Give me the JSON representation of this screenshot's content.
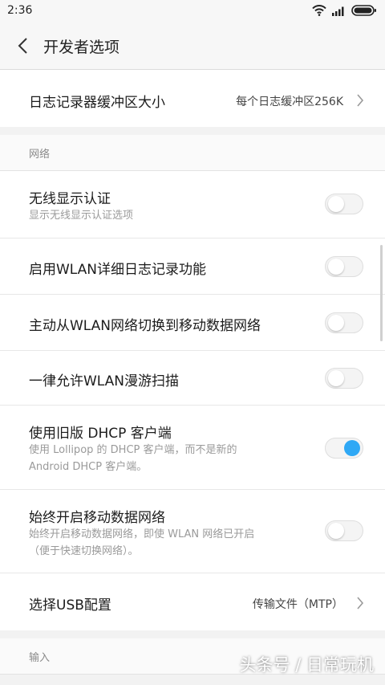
{
  "status_bar": {
    "time": "2:36"
  },
  "header": {
    "title": "开发者选项"
  },
  "log_buffer": {
    "label": "日志记录器缓冲区大小",
    "value": "每个日志缓冲区256K"
  },
  "network_section": {
    "title": "网络"
  },
  "items": [
    {
      "label": "无线显示认证",
      "sub": "显示无线显示认证选项",
      "toggle_on": false
    },
    {
      "label": "启用WLAN详细日志记录功能",
      "toggle_on": false
    },
    {
      "label": "主动从WLAN网络切换到移动数据网络",
      "toggle_on": false
    },
    {
      "label": "一律允许WLAN漫游扫描",
      "toggle_on": false
    },
    {
      "label": "使用旧版 DHCP 客户端",
      "sub1": "使用 Lollipop 的 DHCP 客户端，而不是新的",
      "sub2": "Android DHCP 客户端。",
      "toggle_on": true
    },
    {
      "label": "始终开启移动数据网络",
      "sub1": "始终开启移动数据网络，即使 WLAN 网络已开启",
      "sub2": "（便于快速切换网络）。",
      "toggle_on": false
    }
  ],
  "usb_config": {
    "label": "选择USB配置",
    "value": "传输文件（MTP）"
  },
  "input_section": {
    "title": "输入"
  },
  "watermark": "头条号 / 日常玩机",
  "colors": {
    "accent": "#2fa8f5",
    "background": "#f2f2f2"
  }
}
